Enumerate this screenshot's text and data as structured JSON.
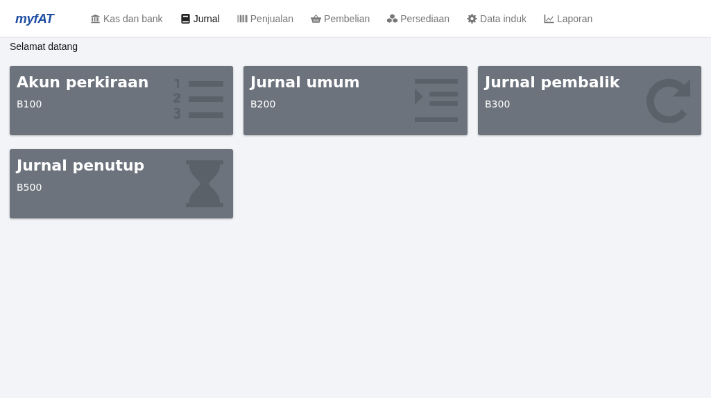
{
  "navbar": {
    "logo": "myfAT",
    "items": [
      {
        "label": "Kas dan bank",
        "selected": false
      },
      {
        "label": "Jurnal",
        "selected": true
      },
      {
        "label": "Penjualan",
        "selected": false
      },
      {
        "label": "Pembelian",
        "selected": false
      },
      {
        "label": "Persediaan",
        "selected": false
      },
      {
        "label": "Data induk",
        "selected": false
      },
      {
        "label": "Laporan",
        "selected": false
      }
    ]
  },
  "welcome": "Selamat datang",
  "cards": [
    {
      "title": "Akun perkiraan",
      "code": "B100"
    },
    {
      "title": "Jurnal umum",
      "code": "B200"
    },
    {
      "title": "Jurnal pembalik",
      "code": "B300"
    },
    {
      "title": "Jurnal penutup",
      "code": "B500"
    }
  ]
}
